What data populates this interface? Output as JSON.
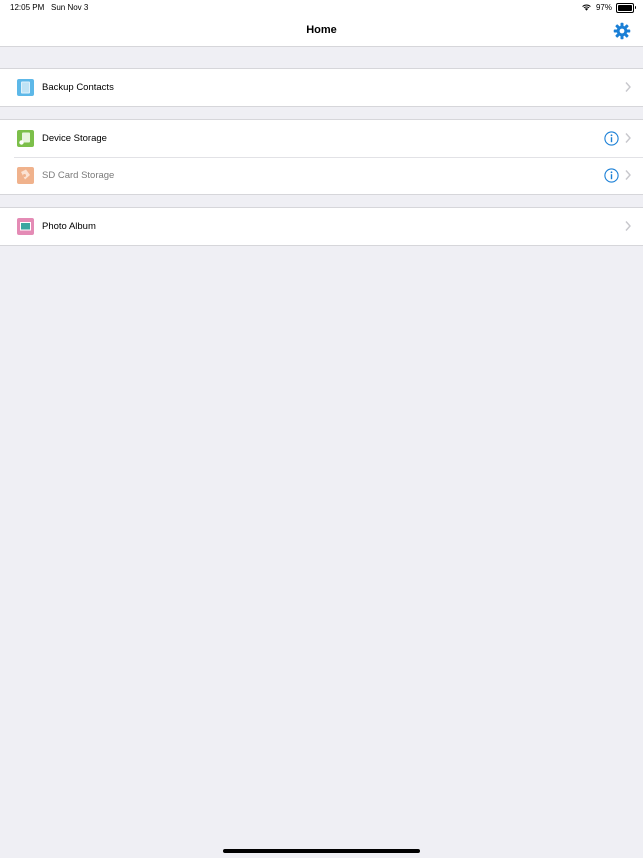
{
  "status_bar": {
    "time": "12:05 PM",
    "date": "Sun Nov 3",
    "battery_percent_text": "97%",
    "battery_level": 0.97
  },
  "nav": {
    "title": "Home",
    "settings_icon": "gear-icon"
  },
  "colors": {
    "accent": "#1a7fd6",
    "background": "#efeff4",
    "chevron": "#c7c7cc",
    "contacts_icon": "#5db8e8",
    "device_icon": "#7cbf4a",
    "sd_icon": "#f0b28c",
    "photo_icon": "#e48bb5"
  },
  "sections": {
    "backup": {
      "contacts": {
        "label": "Backup Contacts",
        "icon": "contacts-book-icon"
      }
    },
    "storage": {
      "device": {
        "label": "Device Storage",
        "icon": "device-storage-icon"
      },
      "sd_card": {
        "label": "SD Card Storage",
        "icon": "sd-card-icon"
      }
    },
    "media": {
      "photo": {
        "label": "Photo Album",
        "icon": "photo-album-icon"
      }
    }
  }
}
